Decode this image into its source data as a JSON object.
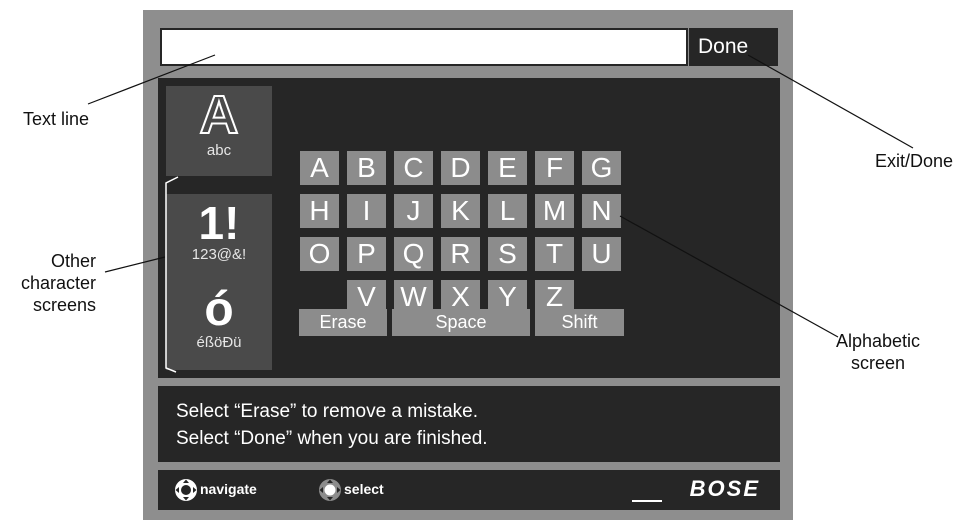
{
  "title_bar": {
    "done_label": "Done"
  },
  "mode_buttons": [
    {
      "glyph": "A",
      "sublabel": "abc"
    },
    {
      "glyph": "1!",
      "sublabel": "123@&!"
    },
    {
      "glyph": "ó",
      "sublabel": "éßöÐü"
    }
  ],
  "keyboard": {
    "rows": [
      [
        "A",
        "B",
        "C",
        "D",
        "E",
        "F",
        "G"
      ],
      [
        "H",
        "I",
        "J",
        "K",
        "L",
        "M",
        "N"
      ],
      [
        "O",
        "P",
        "Q",
        "R",
        "S",
        "T",
        "U"
      ],
      [
        "V",
        "W",
        "X",
        "Y",
        "Z"
      ]
    ],
    "erase_label": "Erase",
    "space_label": "Space",
    "shift_label": "Shift"
  },
  "instructions": {
    "line1": "Select “Erase” to remove a mistake.",
    "line2": "Select “Done” when you are finished."
  },
  "footer": {
    "navigate_label": "navigate",
    "select_label": "select",
    "brand": "BOSE"
  },
  "callouts": {
    "text_line": "Text line",
    "exit_done": "Exit/Done",
    "other_screens": [
      "Other",
      "character",
      "screens"
    ],
    "alphabetic_screen": [
      "Alphabetic",
      "screen"
    ]
  },
  "colors": {
    "frame": "#8e8e8e",
    "panel": "#262626",
    "key": "#8c8c8c",
    "mode_button": "#4a4a4a"
  },
  "icons": [
    "navigate-icon",
    "select-icon"
  ]
}
